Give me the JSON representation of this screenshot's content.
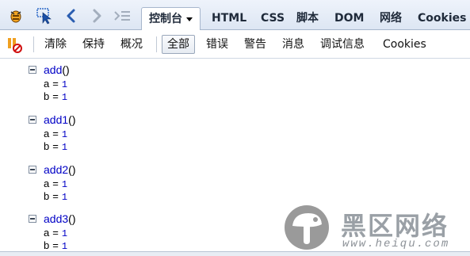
{
  "toolbar": {
    "tabs": [
      {
        "label": "控制台",
        "selected": true
      },
      {
        "label": "HTML"
      },
      {
        "label": "CSS"
      },
      {
        "label": "脚本"
      },
      {
        "label": "DOM"
      },
      {
        "label": "网络"
      },
      {
        "label": "Cookies"
      }
    ],
    "icons": [
      "firebug-icon",
      "inspect-icon",
      "back-icon",
      "forward-icon",
      "command-line-icon"
    ]
  },
  "filters": {
    "actions": [
      "清除",
      "保持",
      "概况"
    ],
    "levels": [
      {
        "label": "全部",
        "active": true
      },
      {
        "label": "错误"
      },
      {
        "label": "警告"
      },
      {
        "label": "消息"
      },
      {
        "label": "调试信息"
      },
      {
        "label": "Cookies"
      }
    ]
  },
  "console": {
    "groups": [
      {
        "name": "add",
        "paren": "()",
        "vars": [
          {
            "name": "a",
            "value": "1"
          },
          {
            "name": "b",
            "value": "1"
          }
        ]
      },
      {
        "name": "add1",
        "paren": "()",
        "vars": [
          {
            "name": "a",
            "value": "1"
          },
          {
            "name": "b",
            "value": "1"
          }
        ]
      },
      {
        "name": "add2",
        "paren": "()",
        "vars": [
          {
            "name": "a",
            "value": "1"
          },
          {
            "name": "b",
            "value": "1"
          }
        ]
      },
      {
        "name": "add3",
        "paren": "()",
        "vars": [
          {
            "name": "a",
            "value": "1"
          },
          {
            "name": "b",
            "value": "1"
          }
        ]
      }
    ]
  },
  "watermark": {
    "title": "黑区网络",
    "url": "www.heiqu.com"
  },
  "colors": {
    "link": "#0000c6",
    "toolbar": "#dde6f3",
    "watermark": "#9aa0a6"
  }
}
